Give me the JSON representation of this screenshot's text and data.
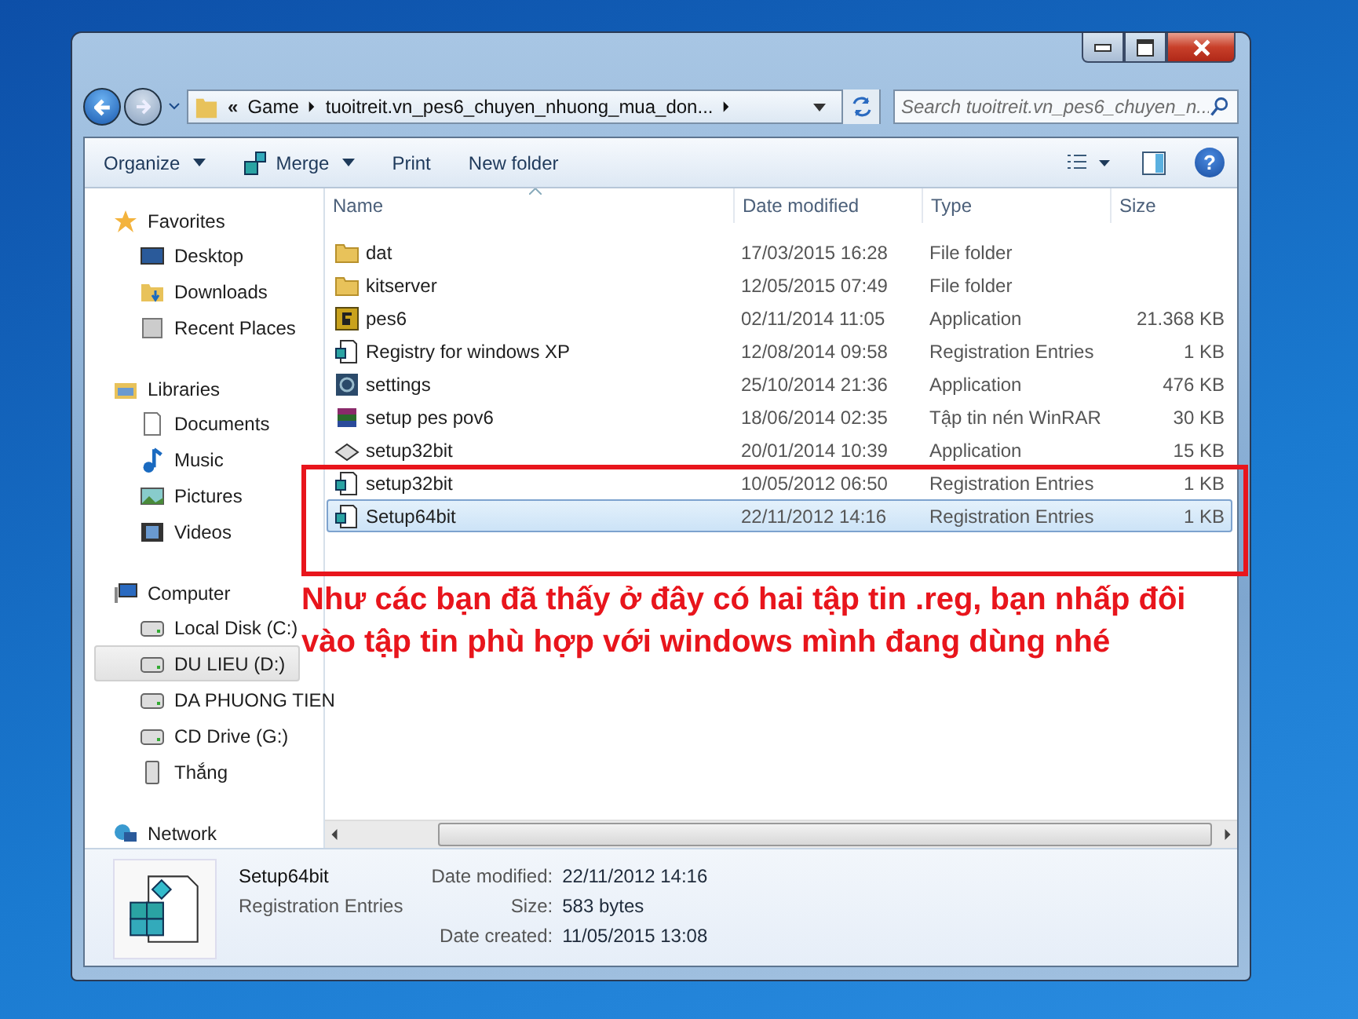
{
  "window": {
    "caption_buttons": [
      {
        "kind": "minimize"
      },
      {
        "kind": "maximize"
      },
      {
        "kind": "close"
      }
    ]
  },
  "address_bar": {
    "overflow_marker": "«",
    "breadcrumbs": [
      "Game",
      "tuoitreit.vn_pes6_chuyen_nhuong_mua_don..."
    ]
  },
  "search": {
    "placeholder": "Search tuoitreit.vn_pes6_chuyen_n..."
  },
  "toolbar": [
    {
      "label": "Organize",
      "kind": "menu"
    },
    {
      "label": "Merge",
      "kind": "icon-menu"
    },
    {
      "label": "Print",
      "kind": "plain"
    },
    {
      "label": "New folder",
      "kind": "plain"
    }
  ],
  "navigation": [
    {
      "label": "Favorites",
      "kind": "star",
      "children": [
        {
          "label": "Desktop",
          "kind": "desktop",
          "selected": false
        },
        {
          "label": "Downloads",
          "kind": "folder",
          "selected": false
        },
        {
          "label": "Recent Places",
          "kind": "recent",
          "selected": false
        }
      ]
    },
    {
      "label": "Libraries",
      "kind": "library",
      "children": [
        {
          "label": "Documents",
          "kind": "document",
          "selected": false
        },
        {
          "label": "Music",
          "kind": "music",
          "selected": false
        },
        {
          "label": "Pictures",
          "kind": "picture",
          "selected": false
        },
        {
          "label": "Videos",
          "kind": "video",
          "selected": false
        }
      ]
    },
    {
      "label": "Computer",
      "kind": "computer",
      "children": [
        {
          "label": "Local Disk (C:)",
          "kind": "drive",
          "selected": false
        },
        {
          "label": "DU LIEU (D:)",
          "kind": "drive",
          "selected": true
        },
        {
          "label": "DA PHUONG TIEN",
          "kind": "drive",
          "selected": false
        },
        {
          "label": "CD Drive (G:)",
          "kind": "drive",
          "selected": false
        },
        {
          "label": "Thắng",
          "kind": "user",
          "selected": false
        }
      ]
    },
    {
      "label": "Network",
      "kind": "network"
    }
  ],
  "help_button": {
    "label": "?"
  },
  "file_list": {
    "columns": [
      {
        "label": "Name",
        "sorted": true
      },
      {
        "label": "Date modified",
        "sorted": false
      },
      {
        "label": "Type",
        "sorted": false
      },
      {
        "label": "Size",
        "sorted": false
      }
    ],
    "rows": [
      {
        "kind": "folder",
        "name": "dat",
        "date": "17/03/2015 16:28",
        "type": "File folder",
        "size": "",
        "selected": false
      },
      {
        "kind": "folder",
        "name": "kitserver",
        "date": "12/05/2015 07:49",
        "type": "File folder",
        "size": "",
        "selected": false
      },
      {
        "kind": "game",
        "name": "pes6",
        "date": "02/11/2014 11:05",
        "type": "Application",
        "size": "21.368 KB",
        "selected": false
      },
      {
        "kind": "reg",
        "name": "Registry for windows XP",
        "date": "12/08/2014 09:58",
        "type": "Registration Entries",
        "size": "1 KB",
        "selected": false
      },
      {
        "kind": "app",
        "name": "settings",
        "date": "25/10/2014 21:36",
        "type": "Application",
        "size": "476 KB",
        "selected": false
      },
      {
        "kind": "archive",
        "name": "setup pes pov6",
        "date": "18/06/2014 02:35",
        "type": "Tập tin nén WinRAR",
        "size": "30 KB",
        "selected": false
      },
      {
        "kind": "installer",
        "name": "setup32bit",
        "date": "20/01/2014 10:39",
        "type": "Application",
        "size": "15 KB",
        "selected": false
      },
      {
        "kind": "reg",
        "name": "setup32bit",
        "date": "10/05/2012 06:50",
        "type": "Registration Entries",
        "size": "1 KB",
        "selected": false
      },
      {
        "kind": "reg",
        "name": "Setup64bit",
        "date": "22/11/2012 14:16",
        "type": "Registration Entries",
        "size": "1 KB",
        "selected": true
      }
    ]
  },
  "annotation": {
    "text": "Như các bạn đã thấy ở đây có hai tập tin .reg, bạn nhấp đôi vào tập tin phù hợp với windows mình đang dùng nhé"
  },
  "details_pane": {
    "name": "Setup64bit",
    "type": "Registration Entries",
    "properties": [
      {
        "label": "Date modified:",
        "value": "22/11/2012 14:16"
      },
      {
        "label": "Size:",
        "value": "583 bytes"
      },
      {
        "label": "Date created:",
        "value": "11/05/2015 13:08"
      }
    ]
  }
}
